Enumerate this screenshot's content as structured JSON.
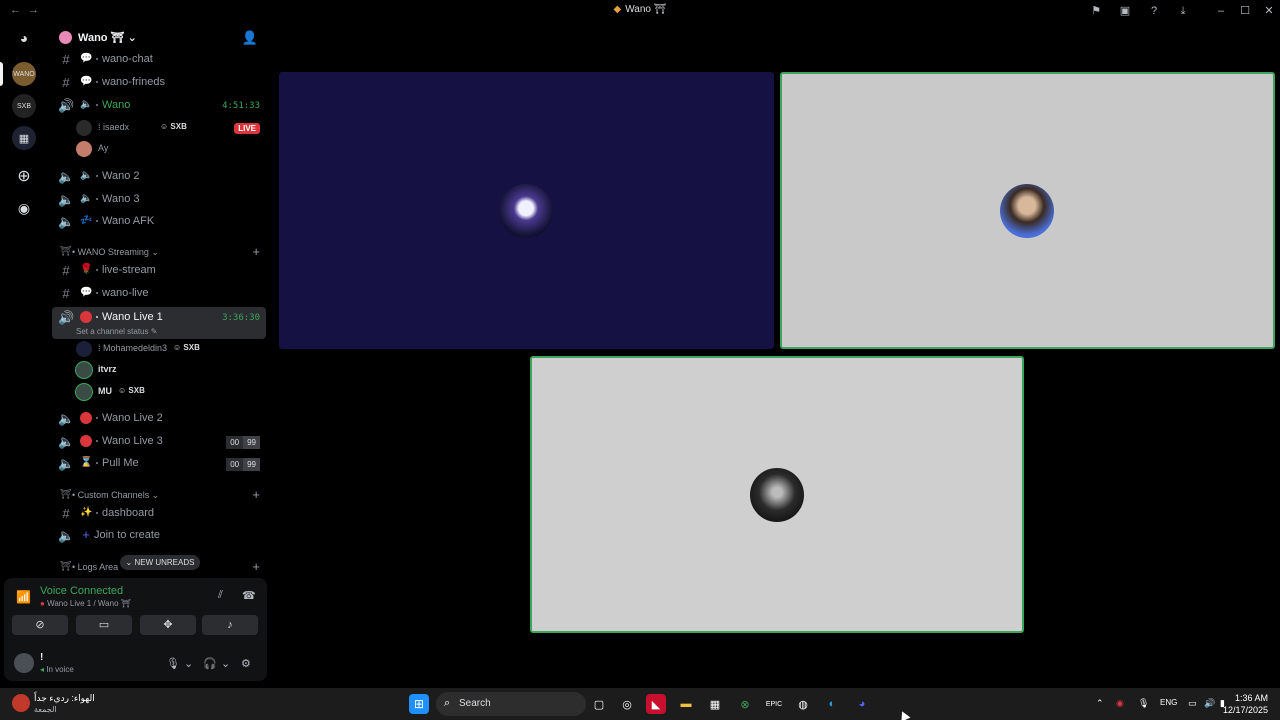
{
  "window": {
    "title": "Wano ⛩",
    "back_icon": "arrow-left-icon",
    "forward_icon": "arrow-right-icon"
  },
  "server": {
    "name": "Wano ⛩",
    "chevron": "⌄"
  },
  "channels_top": [
    {
      "type": "text",
      "emoji": "💬",
      "name": "wano-chat"
    },
    {
      "type": "text",
      "emoji": "💬",
      "name": "wano-frineds"
    }
  ],
  "voice_wano": {
    "name": "Wano",
    "time": "4:51:33"
  },
  "voice_wano_members": [
    {
      "name": "⁞ isaedx",
      "tag": "SXB",
      "live": "LIVE"
    },
    {
      "name": "Ay"
    }
  ],
  "voice_more": [
    {
      "name": "Wano 2"
    },
    {
      "name": "Wano 3"
    },
    {
      "name": "Wano AFK"
    }
  ],
  "category_streaming": {
    "name": "WANO Streaming",
    "add": "+"
  },
  "streaming_text": [
    {
      "name": "live-stream"
    },
    {
      "name": "wano-live"
    }
  ],
  "active_channel": {
    "name": "Wano Live 1",
    "time": "3:36:30",
    "status": "Set a channel status ✎"
  },
  "active_members": [
    {
      "name": "⁞ Mohamedeldin3",
      "tag": "SXB"
    },
    {
      "name": "itvrz"
    },
    {
      "name": "MU",
      "tag": "SXB"
    }
  ],
  "voice_live": [
    {
      "name": "Wano Live 2"
    },
    {
      "name": "Wano Live 3",
      "count": "00",
      "limit": "99"
    },
    {
      "name": "Pull Me",
      "count": "00",
      "limit": "99"
    }
  ],
  "category_custom": {
    "name": "Custom Channels",
    "add": "+"
  },
  "custom_channels": [
    {
      "name": "dashboard"
    },
    {
      "name": "Join to create"
    }
  ],
  "category_logs": {
    "name": "Logs Area",
    "add": "+"
  },
  "new_unreads": "⌄  NEW UNREADS",
  "voice_panel": {
    "title": "Voice Connected",
    "subtitle": "Wano Live 1 / Wano ⛩",
    "user_name": "!",
    "user_status": "In voice"
  },
  "taskbar": {
    "search_placeholder": "Search",
    "weather_title": "الهواء: رديء جداً",
    "weather_sub": "الجمعة",
    "lang": "ENG",
    "time": "1:36 AM",
    "date": "12/17/2025"
  },
  "colors": {
    "accent_green": "#3ba55c",
    "live_red": "#da373c",
    "tile_blue": "#151143",
    "tile_gray": "#c9c9c9",
    "tile_gray_light": "#cfcfcf",
    "speaking_border": "#3ba55c"
  }
}
